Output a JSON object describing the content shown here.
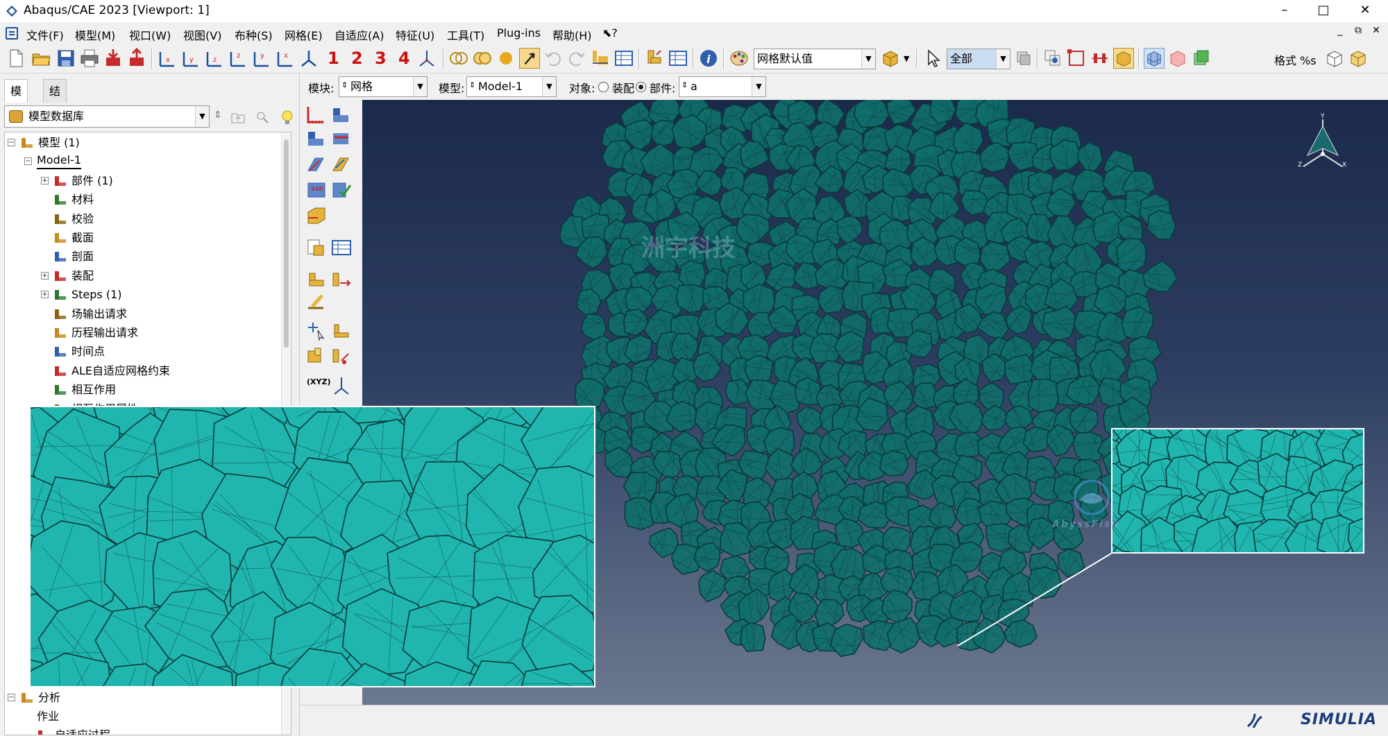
{
  "window": {
    "title": "Abaqus/CAE 2023 [Viewport: 1]",
    "controls": [
      "–",
      "□",
      "✕"
    ]
  },
  "menu": {
    "items": [
      "文件(F)",
      "模型(M)",
      "视口(W)",
      "视图(V)",
      "布种(S)",
      "网格(E)",
      "自适应(A)",
      "特征(U)",
      "工具(T)",
      "Plug-ins",
      "帮助(H)",
      "⬉?"
    ],
    "mdi_controls": [
      "_",
      "⧉",
      "✕"
    ]
  },
  "toolbar": {
    "step_numbers": [
      "1",
      "2",
      "3",
      "4"
    ],
    "mesh_defaults_combo": "网格默认值",
    "selection_combo": "全部",
    "format_label": "格式 %s"
  },
  "context": {
    "module_label": "模块:",
    "module_value": "网格",
    "model_label": "模型:",
    "model_value": "Model-1",
    "object_label": "对象:",
    "assembly_option": "装配",
    "part_option": "部件:",
    "part_value": "a",
    "selected_object": "part"
  },
  "left_panel": {
    "tabs": [
      "模型",
      "结果"
    ],
    "active_tab": "模型",
    "database_combo": "模型数据库",
    "tree": [
      {
        "label": "模型 (1)",
        "level": 0,
        "expander": "−"
      },
      {
        "label": "Model-1",
        "level": 1,
        "expander": "−"
      },
      {
        "label": "部件 (1)",
        "level": 2,
        "expander": "+"
      },
      {
        "label": "材料",
        "level": 2,
        "expander": ""
      },
      {
        "label": "校验",
        "level": 2,
        "expander": ""
      },
      {
        "label": "截面",
        "level": 2,
        "expander": ""
      },
      {
        "label": "剖面",
        "level": 2,
        "expander": ""
      },
      {
        "label": "装配",
        "level": 2,
        "expander": "+"
      },
      {
        "label": "Steps (1)",
        "level": 2,
        "expander": "+"
      },
      {
        "label": "场输出请求",
        "level": 2,
        "expander": ""
      },
      {
        "label": "历程输出请求",
        "level": 2,
        "expander": ""
      },
      {
        "label": "时间点",
        "level": 2,
        "expander": ""
      },
      {
        "label": "ALE自适应网格约束",
        "level": 2,
        "expander": ""
      },
      {
        "label": "相互作用",
        "level": 2,
        "expander": ""
      },
      {
        "label": "相互作用属性",
        "level": 2,
        "expander": ""
      }
    ],
    "tree_bottom": [
      {
        "label": "分析",
        "level": 0,
        "expander": "−"
      },
      {
        "label": "作业",
        "level": 1,
        "expander": ""
      },
      {
        "label": "自适应过程",
        "level": 1,
        "expander": ""
      }
    ]
  },
  "viewport": {
    "watermark_cn": "洲宇科技",
    "watermark_en": "AbyssFish",
    "mesh_color": "#20b5ae",
    "mesh_line_color": "#0b3a3a",
    "brand": "SIMULIA",
    "triad_labels": [
      "Y",
      "Z",
      "X"
    ]
  }
}
